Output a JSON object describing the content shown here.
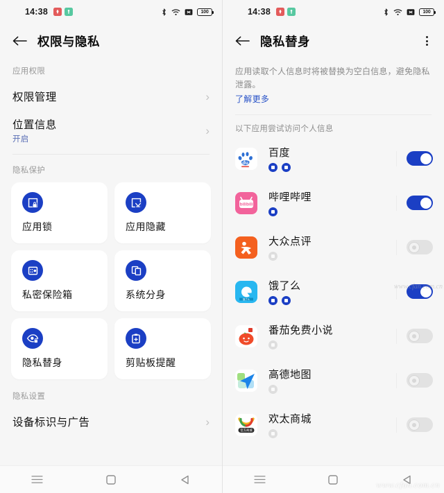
{
  "status_bar": {
    "time": "14:38",
    "badges": [
      {
        "name": "notification-badge-red",
        "color": "#e35b5b"
      },
      {
        "name": "notification-badge-green",
        "color": "#57c8a0"
      }
    ],
    "icons": [
      "bluetooth-icon",
      "wifi-icon",
      "signal-off-icon"
    ],
    "battery": "100"
  },
  "left_screen": {
    "title": "权限与隐私",
    "back_label": "返回",
    "sections": [
      {
        "label": "应用权限",
        "rows": [
          {
            "title": "权限管理",
            "sub": ""
          },
          {
            "title": "位置信息",
            "sub": "开启"
          }
        ]
      },
      {
        "label": "隐私保护",
        "cards": [
          {
            "label": "应用锁",
            "icon": "app-lock-icon"
          },
          {
            "label": "应用隐藏",
            "icon": "app-hide-icon"
          },
          {
            "label": "私密保险箱",
            "icon": "private-safe-icon"
          },
          {
            "label": "系统分身",
            "icon": "system-clone-icon"
          },
          {
            "label": "隐私替身",
            "icon": "privacy-avatar-icon"
          },
          {
            "label": "剪贴板提醒",
            "icon": "clipboard-alert-icon"
          }
        ]
      },
      {
        "label": "隐私设置",
        "rows": [
          {
            "title": "设备标识与广告",
            "sub": ""
          }
        ]
      }
    ]
  },
  "right_screen": {
    "title": "隐私替身",
    "description": "应用读取个人信息时将被替换为空白信息，避免隐私泄露。",
    "learn_more": "了解更多",
    "apps_label": "以下应用尝试访问个人信息",
    "apps": [
      {
        "name": "百度",
        "icon": "baidu-icon",
        "badges": [
          "on",
          "on"
        ],
        "toggle": "on"
      },
      {
        "name": "哔哩哔哩",
        "icon": "bilibili-icon",
        "badges": [
          "on"
        ],
        "toggle": "on"
      },
      {
        "name": "大众点评",
        "icon": "dianping-icon",
        "badges": [
          "off"
        ],
        "toggle": "off"
      },
      {
        "name": "饿了么",
        "icon": "eleme-icon",
        "badges": [
          "on",
          "on"
        ],
        "toggle": "on"
      },
      {
        "name": "番茄免费小说",
        "icon": "fanqie-icon",
        "badges": [
          "off"
        ],
        "toggle": "off"
      },
      {
        "name": "高德地图",
        "icon": "amap-icon",
        "badges": [
          "off"
        ],
        "toggle": "off"
      },
      {
        "name": "欢太商城",
        "icon": "huantai-icon",
        "badges": [
          "off"
        ],
        "toggle": "off"
      }
    ]
  },
  "nav_bar": {
    "recent": "recent-apps-icon",
    "home": "home-icon",
    "back": "back-nav-icon"
  },
  "watermark": "www.cfan.com.cn",
  "colors": {
    "accent": "#1b3fc4",
    "link": "#2a54c8",
    "page_bg": "#f6f6f6",
    "card_bg": "#ffffff"
  }
}
